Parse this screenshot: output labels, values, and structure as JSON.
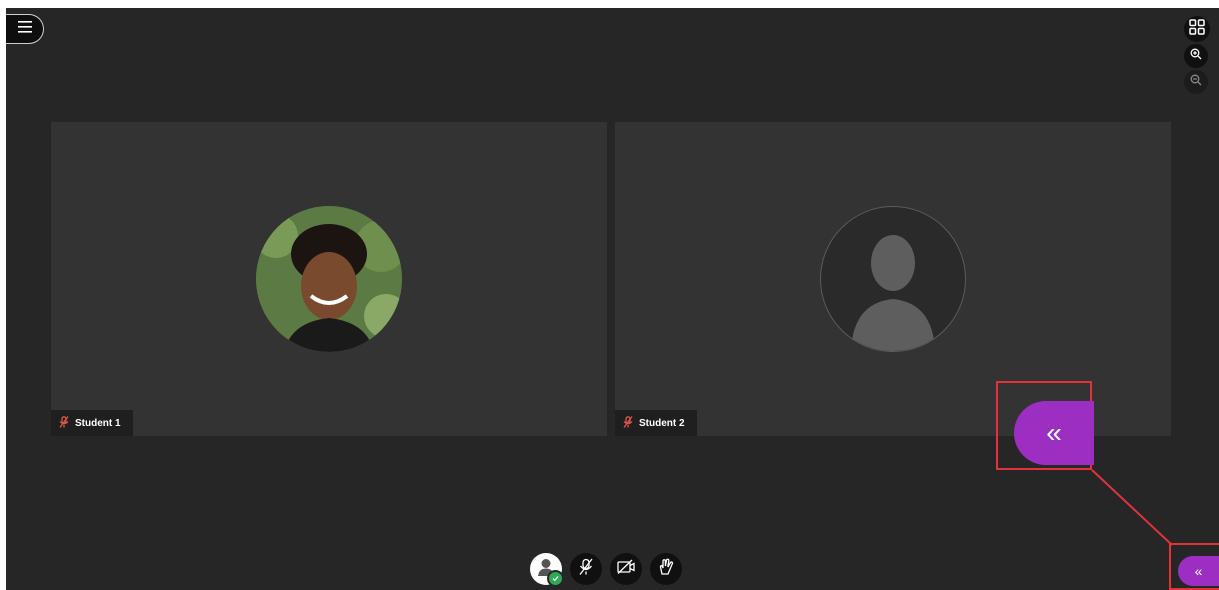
{
  "participants": [
    {
      "name": "Student 1",
      "mic_state": "muted",
      "avatar": "photo"
    },
    {
      "name": "Student 2",
      "mic_state": "muted",
      "avatar": "default-silhouette"
    }
  ],
  "icons": {
    "menu": "hamburger-menu-icon",
    "grid": "grid-view-icon",
    "zoom_in": "zoom-in-icon",
    "zoom_out": "zoom-out-icon",
    "panel": "double-chevron-left-icon",
    "mic_muted": "mic-muted-icon",
    "camera_off": "camera-off-icon",
    "hand": "raise-hand-icon"
  },
  "panel_toggle": {
    "glyph": "«"
  },
  "colors": {
    "accent_purple": "#9c2fc2",
    "highlight_red": "#e0333a",
    "status_green": "#2eaa55",
    "muted_red": "#e0554a",
    "background": "#262626",
    "tile": "#333333"
  }
}
